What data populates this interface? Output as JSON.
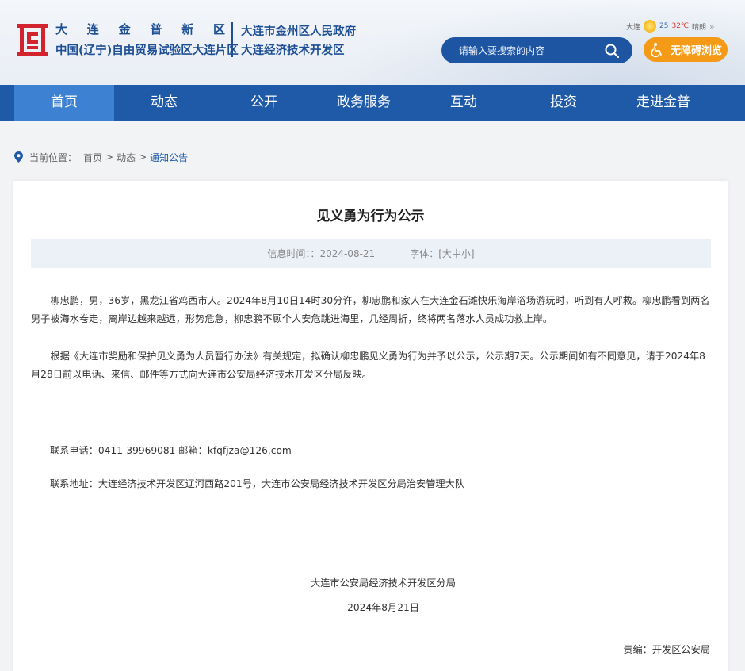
{
  "header": {
    "name_chars": [
      "大",
      "连",
      "金",
      "普",
      "新",
      "区"
    ],
    "subtitle": "中国(辽宁)自由贸易试验区大连片区",
    "gov_line1": "大连市金州区人民政府",
    "gov_line2": "大连经济技术开发区",
    "weather": {
      "city": "大连",
      "low": "25",
      "high": "32℃",
      "condition": "晴朗",
      "more": "»"
    },
    "search_placeholder": "请输入要搜索的内容",
    "accessibility_label": "无障碍浏览"
  },
  "nav": {
    "items": [
      "首页",
      "动态",
      "公开",
      "政务服务",
      "互动",
      "投资",
      "走进金普"
    ],
    "active": "首页"
  },
  "breadcrumb": {
    "prefix": "当前位置：",
    "items": [
      "首页",
      "动态",
      "通知公告"
    ],
    "separator": ">"
  },
  "article": {
    "title": "见义勇为行为公示",
    "info_time_label": "信息时间：：",
    "info_time": "2024-08-21",
    "font_label": "字体：[大中小]",
    "paragraph1": "柳忠鹏，男，36岁，黑龙江省鸡西市人。2024年8月10日14时30分许，柳忠鹏和家人在大连金石滩快乐海岸浴场游玩时，听到有人呼救。柳忠鹏看到两名男子被海水卷走，离岸边越来越远，形势危急，柳忠鹏不顾个人安危跳进海里，几经周折，终将两名落水人员成功救上岸。",
    "paragraph2": "根据《大连市奖励和保护见义勇为人员暂行办法》有关规定，拟确认柳忠鹏见义勇为行为并予以公示，公示期7天。公示期间如有不同意见，请于2024年8月28日前以电话、来信、邮件等方式向大连市公安局经济技术开发区分局反映。",
    "contact_phone": "联系电话：0411-39969081  邮箱：kfqfjza@126.com",
    "contact_address": "联系地址：大连经济技术开发区辽河西路201号，大连市公安局经济技术开发区分局治安管理大队",
    "signature_org": "大连市公安局经济技术开发区分局",
    "signature_date": "2024年8月21日",
    "editor": "责编：开发区公安局"
  }
}
